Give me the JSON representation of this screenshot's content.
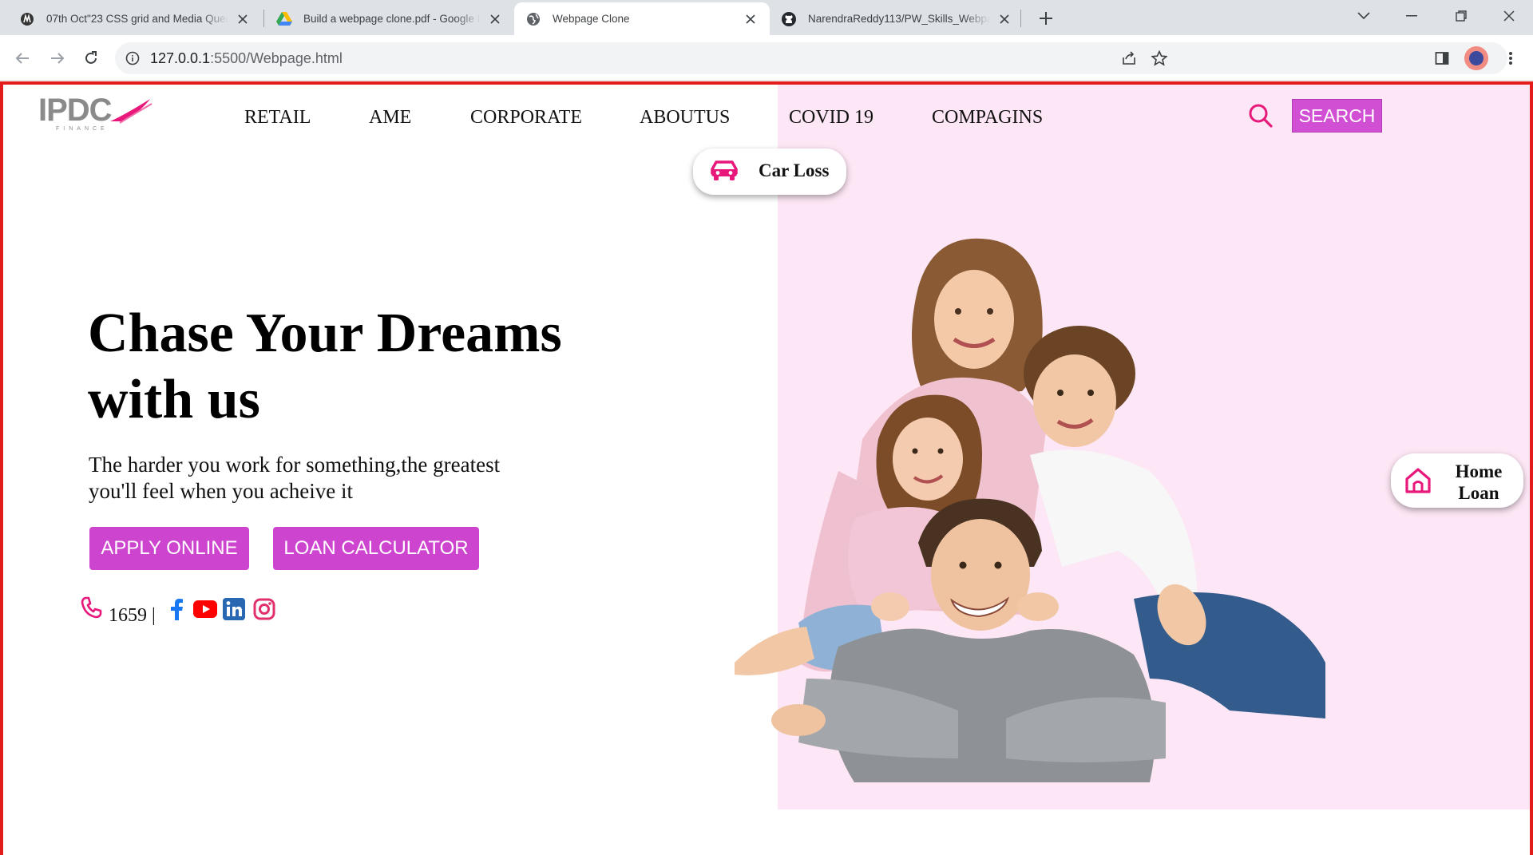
{
  "browser": {
    "tabs": [
      {
        "title": "07th Oct\"23 CSS grid and Media Query",
        "icon": "site-icon",
        "active": false
      },
      {
        "title": "Build a webpage clone.pdf - Google Dr",
        "icon": "google-drive-icon",
        "active": false
      },
      {
        "title": "Webpage Clone",
        "icon": "globe-icon",
        "active": true
      },
      {
        "title": "NarendraReddy113/PW_Skills_Webpage",
        "icon": "github-icon",
        "active": false
      }
    ],
    "url_host": "127.0.0.1",
    "url_path": ":5500/Webpage.html"
  },
  "site": {
    "logo_text": "IPDC",
    "logo_sub": "FINANCE",
    "nav": [
      "RETAIL",
      "AME",
      "CORPORATE",
      "ABOUTUS",
      "COVID 19",
      "COMPAGINS"
    ],
    "search_label": "SEARCH",
    "car_pill": "Car Loss",
    "home_pill": "Home Loan",
    "hero_title": "Chase Your Dreams with us",
    "hero_subtitle": "The harder you work for something,the greatest you'll feel when you acheive it",
    "apply_label": "APPLY ONLINE",
    "calculator_label": "LOAN CALCULATOR",
    "phone_number": "1659 |",
    "socials": [
      "facebook-icon",
      "youtube-icon",
      "linkedin-icon",
      "instagram-icon"
    ]
  },
  "colors": {
    "accent": "#cd45cf",
    "icon_pink": "#e8177a",
    "panel_pink": "#fde6f5",
    "viewport_border": "#e31b1b"
  }
}
